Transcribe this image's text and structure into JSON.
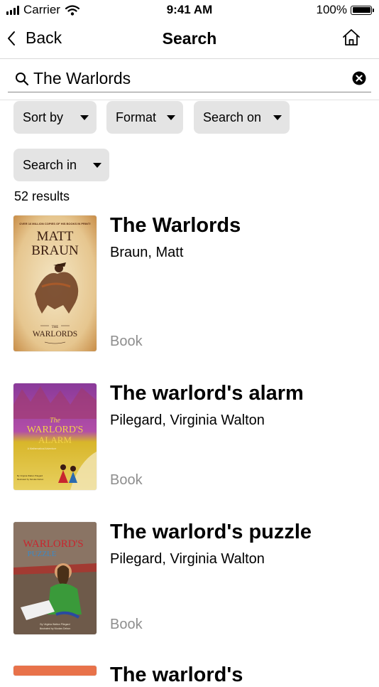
{
  "status_bar": {
    "carrier": "Carrier",
    "time": "9:41 AM",
    "battery": "100%"
  },
  "nav": {
    "back_label": "Back",
    "title": "Search",
    "home_icon": "home-icon"
  },
  "search": {
    "value": "The Warlords",
    "placeholder": ""
  },
  "filters": {
    "sort_by": "Sort by",
    "format": "Format",
    "search_on": "Search on",
    "search_in": "Search in"
  },
  "results_count": "52 results",
  "results": [
    {
      "title": "The Warlords",
      "author": "Braun, Matt",
      "format": "Book",
      "cover": {
        "tagline": "OVER 16 MILLION COPIES OF HIS BOOKS IN PRINT!",
        "author_line1": "MATT",
        "author_line2": "BRAUN",
        "the": "THE",
        "title": "WARLORDS"
      }
    },
    {
      "title": "The warlord's alarm",
      "author": "Pilegard, Virginia Walton",
      "format": "Book",
      "cover": {
        "the": "The",
        "title1": "WARLORD'S",
        "title2": "ALARM",
        "subtitle": "A Mathematical Adventure",
        "credit1": "By Virginia Walton Pilegard",
        "credit2": "Illustrated by Nicolas Debon"
      }
    },
    {
      "title": "The warlord's puzzle",
      "author": "Pilegard, Virginia Walton",
      "format": "Book",
      "cover": {
        "title1": "WARLORD'S",
        "title2": "PUZZLE",
        "credit1": "By Virginia Walton Pilegard",
        "credit2": "Illustrated by Nicolas Debon"
      }
    },
    {
      "title": "The warlord's",
      "author": "",
      "format": ""
    }
  ],
  "colors": {
    "chip_bg": "#e4e4e4",
    "muted_text": "#8e8e8e",
    "divider": "#d9d9d9"
  }
}
